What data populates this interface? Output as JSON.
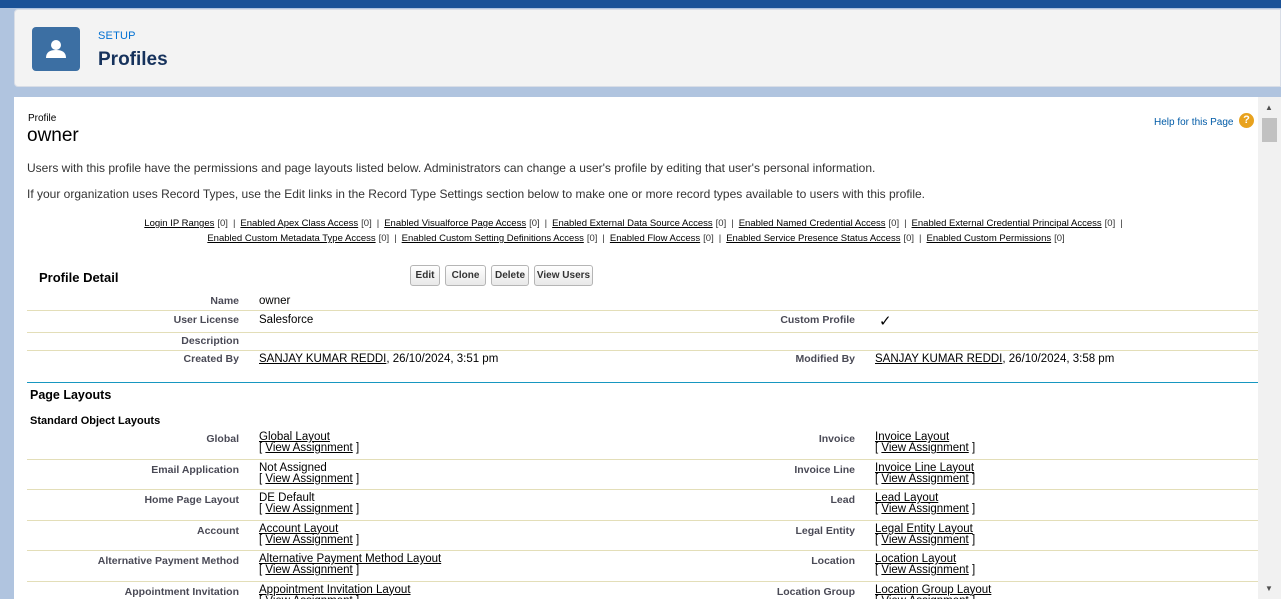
{
  "header": {
    "section": "SETUP",
    "title": "Profiles"
  },
  "profile": {
    "label": "Profile",
    "name": "owner",
    "help_text": "Help for this Page"
  },
  "intro": [
    "Users with this profile have the permissions and page layouts listed below. Administrators can change a user's profile by editing that user's personal information.",
    "If your organization uses Record Types, use the Edit links in the Record Type Settings section below to make one or more record types available to users with this profile."
  ],
  "links_row1": [
    {
      "label": "Login IP Ranges",
      "count": "[0]"
    },
    {
      "label": "Enabled Apex Class Access",
      "count": "[0]"
    },
    {
      "label": "Enabled Visualforce Page Access",
      "count": "[0]"
    },
    {
      "label": "Enabled External Data Source Access",
      "count": "[0]"
    },
    {
      "label": "Enabled Named Credential Access",
      "count": "[0]"
    },
    {
      "label": "Enabled External Credential Principal Access",
      "count": "[0]"
    }
  ],
  "links_row2": [
    {
      "label": "Enabled Custom Metadata Type Access",
      "count": "[0]"
    },
    {
      "label": "Enabled Custom Setting Definitions Access",
      "count": "[0]"
    },
    {
      "label": "Enabled Flow Access",
      "count": "[0]"
    },
    {
      "label": "Enabled Service Presence Status Access",
      "count": "[0]"
    },
    {
      "label": "Enabled Custom Permissions",
      "count": "[0]"
    }
  ],
  "detail": {
    "title": "Profile Detail",
    "buttons": {
      "edit": "Edit",
      "clone": "Clone",
      "delete": "Delete",
      "view_users": "View Users"
    },
    "name_label": "Name",
    "name_value": "owner",
    "license_label": "User License",
    "license_value": "Salesforce",
    "custom_label": "Custom Profile",
    "custom_value": "✓",
    "description_label": "Description",
    "created_label": "Created By",
    "created_user": "SANJAY KUMAR REDDI",
    "created_date": ", 26/10/2024, 3:51 pm",
    "modified_label": "Modified By",
    "modified_user": "SANJAY KUMAR REDDI",
    "modified_date": ", 26/10/2024, 3:58 pm"
  },
  "layouts": {
    "title": "Page Layouts",
    "subtitle": "Standard Object Layouts",
    "view_assignment": "View Assignment",
    "rows": [
      {
        "left_label": "Global",
        "left_value": "Global Layout",
        "left_link": true,
        "right_label": "Invoice",
        "right_value": "Invoice Layout"
      },
      {
        "left_label": "Email Application",
        "left_value": "Not Assigned",
        "left_link": false,
        "right_label": "Invoice Line",
        "right_value": "Invoice Line Layout"
      },
      {
        "left_label": "Home Page Layout",
        "left_value": "DE Default",
        "left_link": false,
        "right_label": "Lead",
        "right_value": "Lead Layout"
      },
      {
        "left_label": "Account",
        "left_value": "Account Layout",
        "left_link": true,
        "right_label": "Legal Entity",
        "right_value": "Legal Entity Layout"
      },
      {
        "left_label": "Alternative Payment Method",
        "left_value": "Alternative Payment Method Layout",
        "left_link": true,
        "right_label": "Location",
        "right_value": "Location Layout"
      },
      {
        "left_label": "Appointment Invitation",
        "left_value": "Appointment Invitation Layout",
        "left_link": true,
        "right_label": "Location Group",
        "right_value": "Location Group Layout"
      }
    ]
  }
}
